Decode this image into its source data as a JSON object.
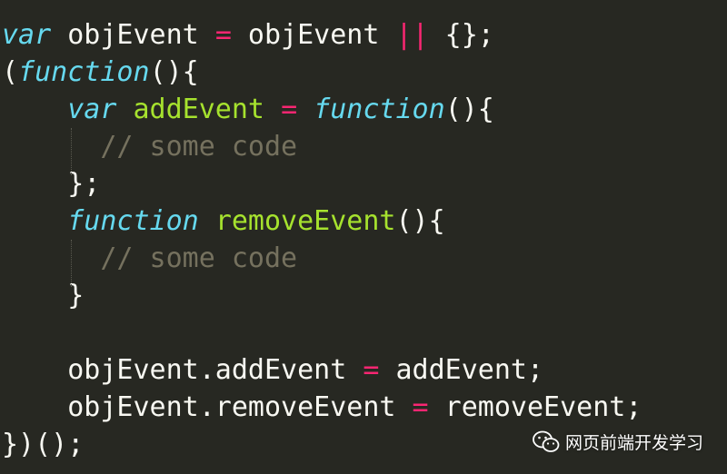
{
  "code_lines": [
    [
      [
        "kw",
        "var"
      ],
      [
        "",
        " objEvent "
      ],
      [
        "op",
        "="
      ],
      [
        "",
        " objEvent "
      ],
      [
        "op",
        "||"
      ],
      [
        "",
        " {};"
      ]
    ],
    [
      [
        "",
        "("
      ],
      [
        "kw",
        "function"
      ],
      [
        "",
        "(){"
      ]
    ],
    [
      [
        "",
        "    "
      ],
      [
        "kw",
        "var"
      ],
      [
        "",
        " "
      ],
      [
        "fn",
        "addEvent"
      ],
      [
        "",
        " "
      ],
      [
        "op",
        "="
      ],
      [
        "",
        " "
      ],
      [
        "kw",
        "function"
      ],
      [
        "",
        "(){"
      ]
    ],
    [
      [
        "",
        "      "
      ],
      [
        "cm",
        "// some code"
      ]
    ],
    [
      [
        "",
        "    };"
      ]
    ],
    [
      [
        "",
        "    "
      ],
      [
        "kw",
        "function"
      ],
      [
        "",
        " "
      ],
      [
        "fn",
        "removeEvent"
      ],
      [
        "",
        "(){"
      ]
    ],
    [
      [
        "",
        "      "
      ],
      [
        "cm",
        "// some code"
      ]
    ],
    [
      [
        "",
        "    }"
      ]
    ],
    [
      [
        "",
        ""
      ]
    ],
    [
      [
        "",
        "    objEvent.addEvent "
      ],
      [
        "op",
        "="
      ],
      [
        "",
        " addEvent;"
      ]
    ],
    [
      [
        "",
        "    objEvent.removeEvent "
      ],
      [
        "op",
        "="
      ],
      [
        "",
        " removeEvent;"
      ]
    ],
    [
      [
        "",
        "})();"
      ]
    ]
  ],
  "watermark": {
    "text": "网页前端开发学习",
    "icon": "wechat-icon"
  }
}
